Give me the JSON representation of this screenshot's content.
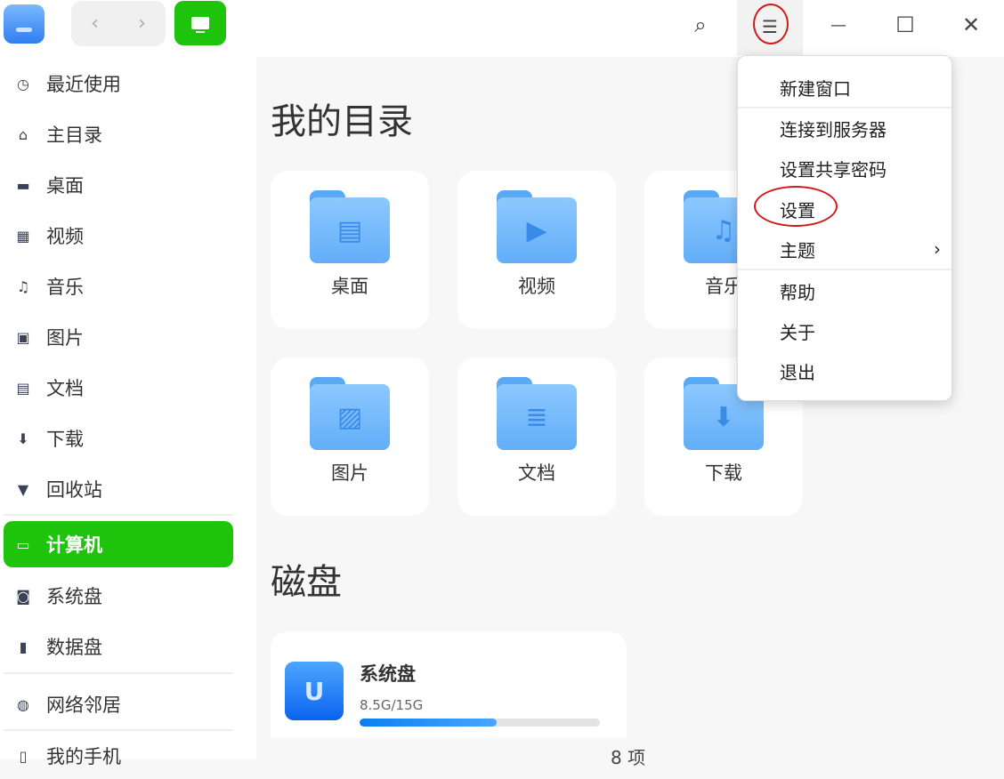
{
  "toolbar": {
    "back": "‹",
    "forward": "›",
    "search": "⌕",
    "menu": "☰",
    "minimize": "—",
    "maximize": "☐",
    "close": "✕"
  },
  "sidebar": {
    "items": [
      {
        "label": "最近使用",
        "icon": "clock-icon",
        "glyph": "◷"
      },
      {
        "label": "主目录",
        "icon": "home-icon",
        "glyph": "⌂"
      },
      {
        "label": "桌面",
        "icon": "desktop-icon",
        "glyph": "▬"
      },
      {
        "label": "视频",
        "icon": "video-icon",
        "glyph": "▦"
      },
      {
        "label": "音乐",
        "icon": "music-icon",
        "glyph": "♫"
      },
      {
        "label": "图片",
        "icon": "picture-icon",
        "glyph": "▣"
      },
      {
        "label": "文档",
        "icon": "document-icon",
        "glyph": "▤"
      },
      {
        "label": "下载",
        "icon": "download-icon",
        "glyph": "⬇"
      },
      {
        "label": "回收站",
        "icon": "trash-icon",
        "glyph": "▼"
      },
      {
        "label": "计算机",
        "icon": "computer-icon",
        "glyph": "▭"
      },
      {
        "label": "系统盘",
        "icon": "disk-icon",
        "glyph": "◙"
      },
      {
        "label": "数据盘",
        "icon": "disk-icon",
        "glyph": "▮"
      },
      {
        "label": "网络邻居",
        "icon": "network-icon",
        "glyph": "◍"
      },
      {
        "label": "我的手机",
        "icon": "phone-icon",
        "glyph": "▯"
      }
    ]
  },
  "main": {
    "my_dirs_title": "我的目录",
    "folders": [
      {
        "label": "桌面",
        "glyph": "▤"
      },
      {
        "label": "视频",
        "glyph": "▶"
      },
      {
        "label": "音乐",
        "glyph": "♫"
      },
      {
        "label": "图片",
        "glyph": "▨"
      },
      {
        "label": "文档",
        "glyph": "≣"
      },
      {
        "label": "下载",
        "glyph": "⬇"
      }
    ],
    "disks_title": "磁盘",
    "disk": {
      "name": "系统盘",
      "size": "8.5G/15G",
      "used_fraction": 0.57,
      "glyph": "U"
    },
    "item_count": "8 项"
  },
  "menu": {
    "items": [
      "新建窗口",
      "连接到服务器",
      "设置共享密码",
      "设置",
      "主题",
      "帮助",
      "关于",
      "退出"
    ],
    "submenu_arrow": "›"
  }
}
